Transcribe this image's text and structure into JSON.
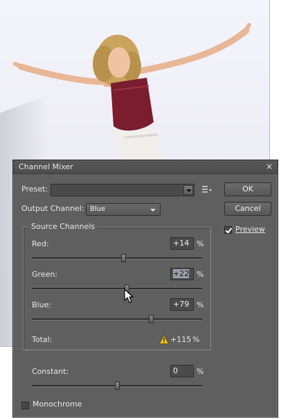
{
  "dialog": {
    "title": "Channel Mixer",
    "close_glyph": "×",
    "preset_label": "Preset:",
    "preset_value": "",
    "output_label": "Output Channel:",
    "output_value": "Blue",
    "ok_label": "OK",
    "cancel_label": "Cancel",
    "preview_label": "Preview",
    "preview_checked": true,
    "source_group_label": "Source Channels",
    "channels": [
      {
        "label": "Red:",
        "value": "+14",
        "unit": "%",
        "slider_pct": 14
      },
      {
        "label": "Green:",
        "value": "+22",
        "unit": "%",
        "slider_pct": 22
      },
      {
        "label": "Blue:",
        "value": "+79",
        "unit": "%",
        "slider_pct": 79
      }
    ],
    "total_label": "Total:",
    "total_value": "+115",
    "total_unit": "%",
    "constant_label": "Constant:",
    "constant_value": "0",
    "constant_unit": "%",
    "constant_slider_pct": 0,
    "monochrome_label": "Monochrome",
    "monochrome_checked": false
  },
  "colors": {
    "dialog_bg": "#5f5f5f",
    "warning": "#f2c618"
  },
  "icons": {
    "close": "close-icon",
    "preset_menu": "menu-icon",
    "warning": "warning-icon",
    "cursor": "pointer-cursor-icon"
  }
}
